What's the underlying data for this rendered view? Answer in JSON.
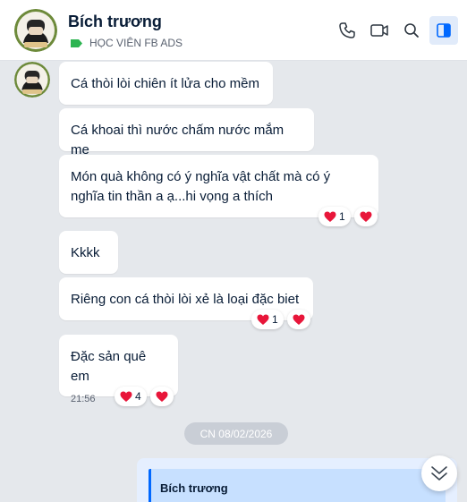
{
  "header": {
    "contact_name": "Bích trương",
    "label": "HỌC VIÊN FB ADS",
    "label_color": "#2db451",
    "actions": [
      "phone-icon",
      "video-call-icon",
      "search-icon",
      "sidebar-toggle-icon"
    ]
  },
  "messages": [
    {
      "text": "Cá thòi lòi chiên ít lửa cho mềm"
    },
    {
      "text": "Cá khoai thì nước chấm nước mắm me"
    },
    {
      "line1": "Món quà không có ý nghĩa vật chất mà có ý",
      "line2": "nghĩa tin thần a ạ...hi vọng a thích",
      "reaction_count": "1"
    },
    {
      "text": "Kkkk"
    },
    {
      "text": "Riêng con cá thòi lòi xẻ là loại đặc biet",
      "reaction_count": "1"
    },
    {
      "text": "Đặc sản quê em",
      "time": "21:56",
      "reaction_count": "4"
    }
  ],
  "date_divider": "CN 08/02/2026",
  "quoted_message": {
    "sender": "Bích trương"
  },
  "colors": {
    "accent": "#0068ff",
    "heart": "#e8163a",
    "background": "#e5e8ec"
  }
}
